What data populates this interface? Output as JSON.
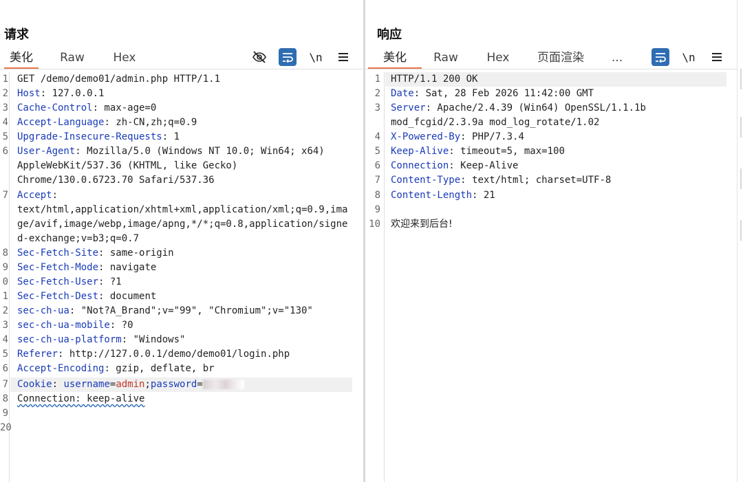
{
  "request": {
    "title": "请求",
    "tabs": [
      "美化",
      "Raw",
      "Hex"
    ],
    "tools": {
      "hide_icon": "eye-slash",
      "wrap_icon": "wrap-lines",
      "newline_label": "\\n",
      "menu_icon": "hamburger"
    },
    "line_numbers": [
      "1",
      "2",
      "3",
      "4",
      "5",
      "6",
      "7",
      "8",
      "8",
      "9",
      "0",
      "1",
      "2",
      "3",
      "4",
      "5",
      "6",
      "7",
      "8",
      "9",
      "20"
    ],
    "lines": {
      "l1": "GET /demo/demo01/admin.php HTTP/1.1",
      "host_k": "Host",
      "host_v": ": 127.0.0.1",
      "cc_k": "Cache-Control",
      "cc_v": ": max-age=0",
      "al_k": "Accept-Language",
      "al_v": ": zh-CN,zh;q=0.9",
      "uir_k": "Upgrade-Insecure-Requests",
      "uir_v": ": 1",
      "ua_k": "User-Agent",
      "ua_v": ": Mozilla/5.0 (Windows NT 10.0; Win64; x64)",
      "ua_v2": "AppleWebKit/537.36 (KHTML, like Gecko)",
      "ua_v3": "Chrome/130.0.6723.70 Safari/537.36",
      "acc_k": "Accept",
      "acc_v": ":",
      "acc_v2": "text/html,application/xhtml+xml,application/xml;q=0.9,ima",
      "acc_v3": "ge/avif,image/webp,image/apng,*/*;q=0.8,application/signe",
      "acc_v4": "d-exchange;v=b3;q=0.7",
      "sfs_k": "Sec-Fetch-Site",
      "sfs_v": ": same-origin",
      "sfm_k": "Sec-Fetch-Mode",
      "sfm_v": ": navigate",
      "sfu_k": "Sec-Fetch-User",
      "sfu_v": ": ?1",
      "sfd_k": "Sec-Fetch-Dest",
      "sfd_v": ": document",
      "scu_k": "sec-ch-ua",
      "scu_v": ": \"Not?A_Brand\";v=\"99\", \"Chromium\";v=\"130\"",
      "scm_k": "sec-ch-ua-mobile",
      "scm_v": ": ?0",
      "scp_k": "sec-ch-ua-platform",
      "scp_v": ": \"Windows\"",
      "ref_k": "Referer",
      "ref_v": ": http://127.0.0.1/demo/demo01/login.php",
      "ae_k": "Accept-Encoding",
      "ae_v": ": gzip, deflate, br",
      "ck_k": "Cookie",
      "ck_sep": ": ",
      "ck_uk": "username",
      "ck_eq": "=",
      "ck_uv": "admin",
      "ck_semi": ";",
      "ck_pk": "password",
      "ck_eq2": "=",
      "conn": "Connection: keep-alive"
    }
  },
  "response": {
    "title": "响应",
    "tabs": [
      "美化",
      "Raw",
      "Hex",
      "页面渲染",
      "..."
    ],
    "tools": {
      "wrap_icon": "wrap-lines",
      "newline_label": "\\n",
      "menu_icon": "hamburger"
    },
    "line_numbers": [
      "1",
      "2",
      "3",
      "",
      "4",
      "5",
      "6",
      "7",
      "8",
      "9",
      "10"
    ],
    "lines": {
      "l1": "HTTP/1.1 200 OK",
      "date_k": "Date",
      "date_v": ": Sat, 28 Feb 2026 11:42:00 GMT",
      "srv_k": "Server",
      "srv_v": ": Apache/2.4.39 (Win64) OpenSSL/1.1.1b",
      "srv_v2": "mod_fcgid/2.3.9a mod_log_rotate/1.02",
      "xpb_k": "X-Powered-By",
      "xpb_v": ": PHP/7.3.4",
      "ka_k": "Keep-Alive",
      "ka_v": ": timeout=5, max=100",
      "conn_k": "Connection",
      "conn_v": ": Keep-Alive",
      "ct_k": "Content-Type",
      "ct_v": ": text/html; charset=UTF-8",
      "cl_k": "Content-Length",
      "cl_v": ": 21",
      "body": "欢迎来到后台!"
    }
  },
  "view_toggle": {
    "options": [
      "side-by-side",
      "stacked-horizontal",
      "single"
    ],
    "selected": "side-by-side"
  },
  "colors": {
    "header_key": "#1a3bb8",
    "accent_tab": "#e8764c",
    "tool_blue": "#2f6db3",
    "cookie_value": "#c0392b"
  }
}
